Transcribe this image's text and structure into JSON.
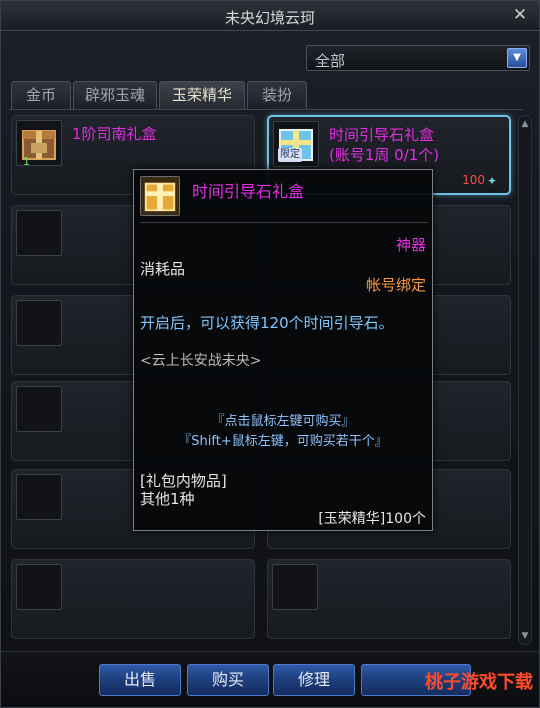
{
  "window": {
    "title": "未央幻境云珂",
    "close_label": "✕"
  },
  "filter": {
    "selected": "全部"
  },
  "tabs": [
    {
      "label": "金币"
    },
    {
      "label": "辟邪玉魂"
    },
    {
      "label": "玉荣精华"
    },
    {
      "label": "装扮"
    }
  ],
  "items": [
    {
      "name": "1阶司南礼盒",
      "qty": "1"
    },
    {
      "name": "时间引导石礼盒",
      "name_line2": "(账号1周 0/1个)",
      "tag": "限定",
      "price": "100"
    }
  ],
  "tooltip": {
    "name": "时间引导石礼盒",
    "grade": "神器",
    "type": "消耗品",
    "bind": "帐号绑定",
    "description": "开启后，可以获得120个时间引导石。",
    "source": "<云上长安战未央>",
    "hint_1": "『点击鼠标左键可购买』",
    "hint_2": "『Shift+鼠标左键，可购买若干个』",
    "contents_label": "[礼包内物品]",
    "contents_value": "其他1种",
    "price": "[玉荣精华]100个"
  },
  "footer": {
    "sell": "出售",
    "buy": "购买",
    "repair": "修理",
    "watermark": "桃子游戏下载"
  },
  "colors": {
    "item_name": "#e02fe0",
    "selected_border": "#6ec3e8",
    "bind": "#ff9a3c",
    "description": "#7ec8ff",
    "button": "#2f5aa7"
  }
}
